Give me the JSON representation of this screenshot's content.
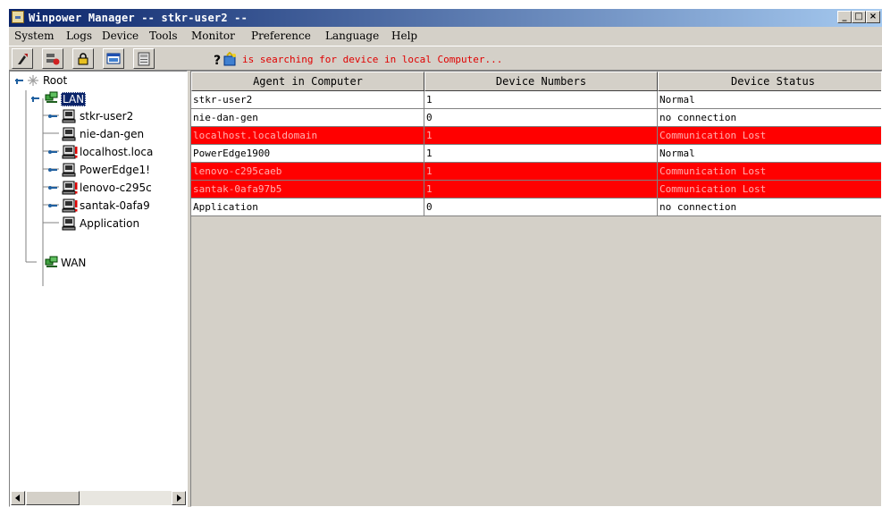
{
  "window": {
    "title": "Winpower Manager -- stkr-user2 --",
    "controls": [
      "_",
      "□",
      "×"
    ]
  },
  "menu": [
    "System",
    "Logs",
    "Device",
    "Tools",
    "Monitor",
    "Preference",
    "Language",
    "Help"
  ],
  "toolbar": {
    "buttons": [
      "tools-icon",
      "device-list-icon",
      "lock-icon",
      "window-icon",
      "calculator-icon"
    ],
    "status_icons": [
      "help-icon",
      "search-device-icon"
    ],
    "status_text": "is searching for device in local Computer...",
    "status_color": "#e00000"
  },
  "tree": {
    "root": "Root",
    "lan": "LAN",
    "lan_items": [
      "stkr-user2",
      "nie-dan-gen",
      "localhost.loca",
      "PowerEdge1!",
      "lenovo-c295c",
      "santak-0afa9",
      "Application"
    ],
    "wan": "WAN"
  },
  "table": {
    "columns": [
      "Agent in Computer",
      "Device Numbers",
      "Device Status"
    ],
    "rows": [
      {
        "agent": "stkr-user2",
        "devices": "1",
        "status": "Normal",
        "state": "normal"
      },
      {
        "agent": "nie-dan-gen",
        "devices": "0",
        "status": "no connection",
        "state": "normal"
      },
      {
        "agent": "localhost.localdomain",
        "devices": "1",
        "status": "Communication Lost",
        "state": "lost"
      },
      {
        "agent": "PowerEdge1900",
        "devices": "1",
        "status": "Normal",
        "state": "normal"
      },
      {
        "agent": "lenovo-c295caeb",
        "devices": "1",
        "status": "Communication Lost",
        "state": "lost"
      },
      {
        "agent": "santak-0afa97b5",
        "devices": "1",
        "status": "Communication Lost",
        "state": "lost"
      },
      {
        "agent": "Application",
        "devices": "0",
        "status": "no connection",
        "state": "normal"
      }
    ]
  },
  "colors": {
    "lost_row": "#ff0000",
    "title_bar": "#0a246a",
    "selected": "#0a246a"
  }
}
